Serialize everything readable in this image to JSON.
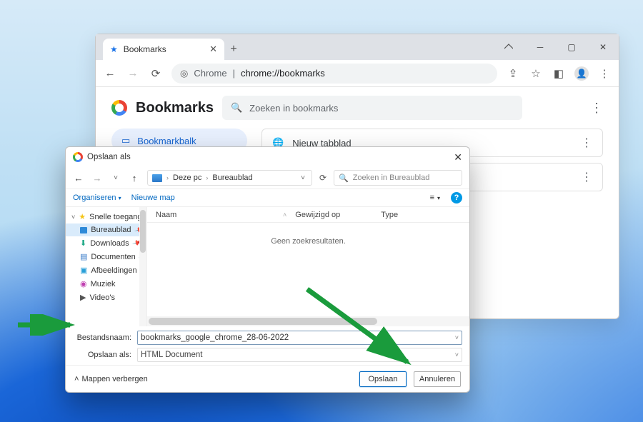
{
  "chrome": {
    "tab_title": "Bookmarks",
    "omnibox_prefix": "Chrome",
    "omnibox_sep": " | ",
    "omnibox_url": "chrome://bookmarks",
    "page_title": "Bookmarks",
    "search_placeholder": "Zoeken in bookmarks",
    "sidebar_folder": "Bookmarkbalk",
    "item_label": "Nieuw tabblad"
  },
  "dialog": {
    "title": "Opslaan als",
    "crumb_root": "Deze pc",
    "crumb_leaf": "Bureaublad",
    "search_placeholder": "Zoeken in Bureaublad",
    "organize": "Organiseren",
    "new_folder": "Nieuwe map",
    "tree": {
      "quick_access": "Snelle toegang",
      "desktop": "Bureaublad",
      "downloads": "Downloads",
      "documents": "Documenten",
      "pictures": "Afbeeldingen",
      "music": "Muziek",
      "videos": "Video's"
    },
    "columns": {
      "name": "Naam",
      "modified": "Gewijzigd op",
      "type": "Type"
    },
    "empty": "Geen zoekresultaten.",
    "filename_label": "Bestandsnaam:",
    "filename_value": "bookmarks_google_chrome_28-06-2022",
    "filetype_label": "Opslaan als:",
    "filetype_value": "HTML Document",
    "hide_folders": "Mappen verbergen",
    "save": "Opslaan",
    "cancel": "Annuleren"
  }
}
